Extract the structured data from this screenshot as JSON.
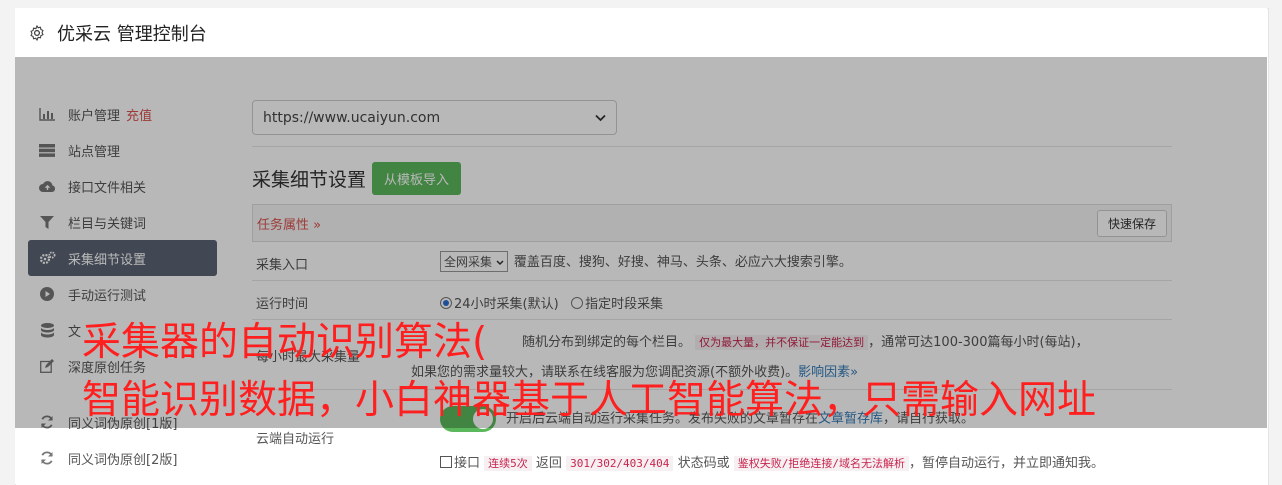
{
  "header": {
    "title": "优采云 管理控制台",
    "icon": "gear-icon"
  },
  "sidebar": {
    "items": [
      {
        "label": "账户管理",
        "extra": "充值",
        "icon": "bar-chart-icon"
      },
      {
        "label": "站点管理",
        "icon": "server-icon"
      },
      {
        "label": "接口文件相关",
        "icon": "cloud-upload-icon"
      },
      {
        "label": "栏目与关键词",
        "icon": "filter-icon"
      },
      {
        "label": "采集细节设置",
        "icon": "cogs-icon",
        "active": true
      },
      {
        "label": "手动运行测试",
        "icon": "play-circle-icon"
      },
      {
        "label": "文",
        "icon": "database-icon"
      },
      {
        "label": "深度原创任务",
        "icon": "edit-icon"
      },
      {
        "label": "同义词伪原创[1版]",
        "icon": "refresh-icon"
      },
      {
        "label": "同义词伪原创[2版]",
        "icon": "refresh-icon"
      }
    ]
  },
  "main": {
    "url_select": "https://www.ucaiyun.com",
    "section_title": "采集细节设置",
    "import_button": "从模板导入",
    "task_props": "任务属性 »",
    "quick_save": "快速保存",
    "rows": {
      "entry": {
        "label": "采集入口",
        "select": "全网采集",
        "desc": "覆盖百度、搜狗、好搜、神马、头条、必应六大搜索引擎。"
      },
      "time": {
        "label": "运行时间",
        "opt1": "24小时采集(默认)",
        "opt2": "指定时段采集"
      },
      "amount": {
        "label": "每小时最大采集量",
        "line1_a": "随机分布到绑定的每个栏目。",
        "line1_code": "仅为最大量，并不保证一定能达到",
        "line1_b": "，通常可达100-300篇每小时(每站)，",
        "line2_a": "如果您的需求量较大，请联系在线客服为您调配资源(不额外收费)。",
        "line2_link": "影响因素»"
      },
      "cloud": {
        "label": "云端自动运行",
        "line1_a": "开启后云端自动运行采集任务。发布失败的文章暂存在",
        "line1_link": "文章暂存库",
        "line1_b": "，请自行获取。",
        "line2_a": "接口",
        "code1": "连续5次",
        "line2_b": "返回",
        "code2": "301/302/403/404",
        "line2_c": "状态码或",
        "code3": "鉴权失败/拒绝连接/域名无法解析",
        "line2_d": "，暂停自动运行，并立即通知我。"
      }
    }
  },
  "caption": {
    "line1": "采集器的自动识别算法(",
    "line2": "智能识别数据，小白神器基于人工智能算法，只需输入网址"
  }
}
